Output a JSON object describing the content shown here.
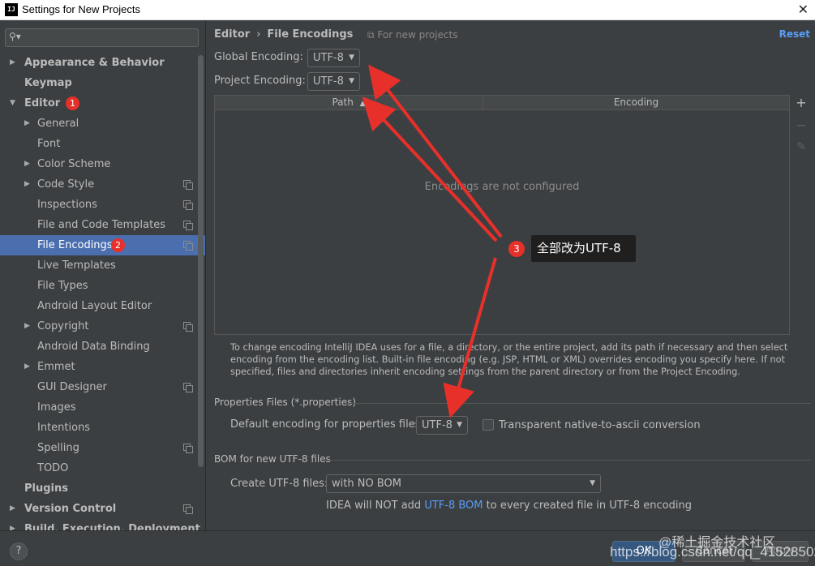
{
  "window": {
    "app_icon": "intellij-icon",
    "app_icon_text": "IJ",
    "title": "Settings for New Projects",
    "close_glyph": "✕"
  },
  "search": {
    "placeholder": "",
    "icon": "search-icon"
  },
  "sidebar": {
    "items": [
      {
        "label": "Appearance & Behavior",
        "arrow": "▶"
      },
      {
        "label": "Keymap"
      },
      {
        "label": "Editor",
        "arrow": "▼",
        "badge": "1"
      },
      {
        "label": "General",
        "arrow": "▶"
      },
      {
        "label": "Font"
      },
      {
        "label": "Color Scheme",
        "arrow": "▶"
      },
      {
        "label": "Code Style",
        "arrow": "▶"
      },
      {
        "label": "Inspections"
      },
      {
        "label": "File and Code Templates"
      },
      {
        "label": "File Encodings",
        "badge": "2"
      },
      {
        "label": "Live Templates"
      },
      {
        "label": "File Types"
      },
      {
        "label": "Android Layout Editor"
      },
      {
        "label": "Copyright",
        "arrow": "▶"
      },
      {
        "label": "Android Data Binding"
      },
      {
        "label": "Emmet",
        "arrow": "▶"
      },
      {
        "label": "GUI Designer"
      },
      {
        "label": "Images"
      },
      {
        "label": "Intentions"
      },
      {
        "label": "Spelling"
      },
      {
        "label": "TODO"
      },
      {
        "label": "Plugins"
      },
      {
        "label": "Version Control",
        "arrow": "▶"
      },
      {
        "label": "Build, Execution, Deployment",
        "arrow": "▶"
      }
    ]
  },
  "header": {
    "breadcrumb_parent": "Editor",
    "breadcrumb_sep": "›",
    "breadcrumb_current": "File Encodings",
    "scope_icon": "copy-icon",
    "scope_note": "For new projects",
    "reset_label": "Reset"
  },
  "encoding": {
    "global_label": "Global Encoding:",
    "global_value": "UTF-8",
    "project_label": "Project Encoding:",
    "project_value": "UTF-8"
  },
  "table": {
    "columns": [
      "Path",
      "Encoding"
    ],
    "sort_glyph": "▲",
    "empty_text": "Encodings are not configured",
    "tools": [
      "+",
      "−",
      "✎"
    ]
  },
  "help_text": "To change encoding IntelliJ IDEA uses for a file, a directory, or the entire project, add its path if necessary and then select encoding from the encoding list. Built-in file encoding (e.g. JSP, HTML or XML) overrides encoding you specify here. If not specified, files and directories inherit encoding settings from the parent directory or from the Project Encoding.",
  "properties": {
    "section_title": "Properties Files (*.properties)",
    "default_label": "Default encoding for properties files:",
    "default_value": "UTF-8",
    "native_label": "Transparent native-to-ascii conversion"
  },
  "bom": {
    "section_title": "BOM for new UTF-8 files",
    "create_label": "Create UTF-8 files:",
    "create_value": "with NO BOM",
    "note_prefix": "IDEA will NOT add",
    "note_link": "UTF-8 BOM",
    "note_suffix": "to every created file in UTF-8 encoding"
  },
  "footer": {
    "help_glyph": "?",
    "ok_label": "OK",
    "cancel_label": "Cancel",
    "apply_label": "Apply"
  },
  "annotation": {
    "badge": "3",
    "text": "全部改为UTF-8",
    "color": "#e8302a"
  },
  "watermark": {
    "cn": "@稀土掘金技术社区",
    "url": "https://blog.csdn.net/qq_41528502"
  },
  "colors": {
    "background": "#3c3f41",
    "selection": "#4b6eaf",
    "link": "#589df6",
    "ok_button": "#365880"
  }
}
